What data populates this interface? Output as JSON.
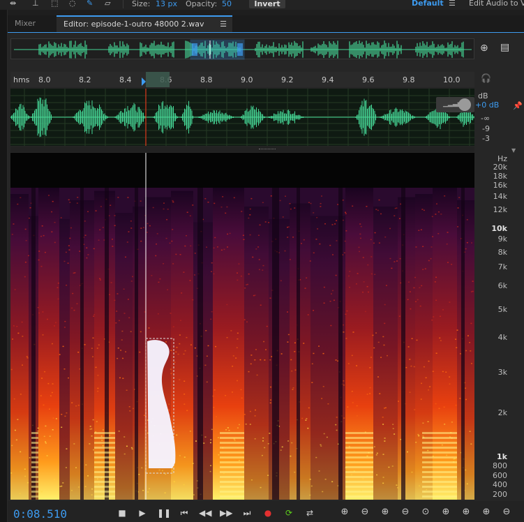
{
  "toolbar": {
    "size_label": "Size:",
    "size_value": "13 px",
    "opacity_label": "Opacity:",
    "opacity_value": "50",
    "invert_label": "Invert",
    "workspace_default": "Default",
    "workspace_menu_icon": "menu-lines",
    "edit_audio_label": "Edit Audio to V"
  },
  "tabs": {
    "mixer": "Mixer",
    "editor": "Editor: episode-1-outro 48000 2.wav",
    "editor_menu_icon": "hamburger"
  },
  "ruler": {
    "unit": "hms",
    "ticks": [
      "8.0",
      "8.2",
      "8.4",
      "8.6",
      "8.8",
      "9.0",
      "9.2",
      "9.4",
      "9.6",
      "9.8",
      "10.0"
    ]
  },
  "waveform": {
    "db_unit": "dB",
    "gain_value": "+0 dB",
    "scale": [
      "-∞",
      "-9",
      "-3"
    ]
  },
  "spectral": {
    "unit": "Hz",
    "labels": [
      "20k",
      "18k",
      "16k",
      "14k",
      "12k",
      "10k",
      "9k",
      "8k",
      "7k",
      "6k",
      "5k",
      "4k",
      "3k",
      "2k",
      "1k",
      "800",
      "600",
      "400",
      "200"
    ],
    "bold_labels": [
      "10k",
      "1k"
    ]
  },
  "transport": {
    "timecode": "0:08.510"
  },
  "colors": {
    "accent": "#3d9bf0",
    "waveform": "#45d695",
    "playhead": "#e03a1c",
    "record": "#e33030",
    "loop": "#5ed11b"
  }
}
